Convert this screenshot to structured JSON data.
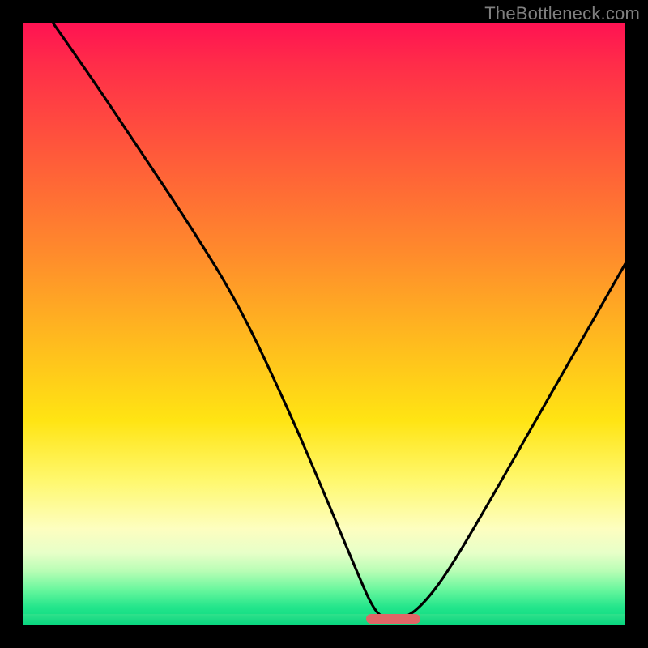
{
  "watermark": "TheBottleneck.com",
  "chart_data": {
    "type": "line",
    "title": "",
    "xlabel": "",
    "ylabel": "",
    "xlim": [
      0,
      100
    ],
    "ylim": [
      0,
      100
    ],
    "grid": false,
    "legend": false,
    "series": [
      {
        "name": "bottleneck-curve",
        "x": [
          5,
          12,
          20,
          28,
          36,
          44,
          50,
          55,
          58,
          60,
          63,
          66,
          70,
          76,
          84,
          92,
          100
        ],
        "y": [
          100,
          90,
          78,
          66,
          53,
          36,
          22,
          10,
          3,
          1,
          1,
          3,
          8,
          18,
          32,
          46,
          60
        ]
      }
    ],
    "optimal_range": {
      "x_start": 57,
      "x_end": 66
    },
    "gradient_colors": {
      "top": "#ff1252",
      "mid": "#ffe413",
      "bottom": "#06d77f"
    },
    "marker_color": "#e06666"
  }
}
